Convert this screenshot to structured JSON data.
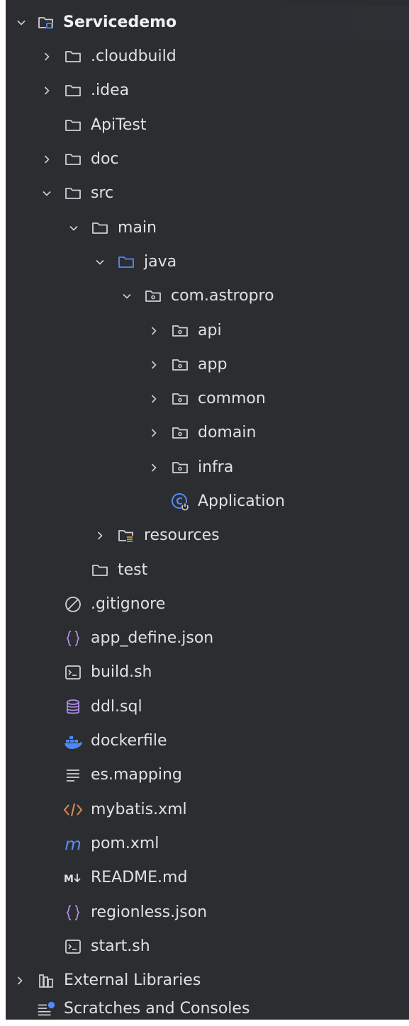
{
  "tree": {
    "root": {
      "label": "Servicedemo"
    },
    "items": [
      {
        "label": ".cloudbuild"
      },
      {
        "label": ".idea"
      },
      {
        "label": "ApiTest"
      },
      {
        "label": "doc"
      },
      {
        "label": "src"
      },
      {
        "label": "main"
      },
      {
        "label": "java"
      },
      {
        "label": "com.astropro"
      },
      {
        "label": "api"
      },
      {
        "label": "app"
      },
      {
        "label": "common"
      },
      {
        "label": "domain"
      },
      {
        "label": "infra"
      },
      {
        "label": "Application"
      },
      {
        "label": "resources"
      },
      {
        "label": "test"
      },
      {
        "label": ".gitignore"
      },
      {
        "label": "app_define.json"
      },
      {
        "label": "build.sh"
      },
      {
        "label": "ddl.sql"
      },
      {
        "label": "dockerfile"
      },
      {
        "label": "es.mapping"
      },
      {
        "label": "mybatis.xml"
      },
      {
        "label": "pom.xml"
      },
      {
        "label": "README.md"
      },
      {
        "label": "regionless.json"
      },
      {
        "label": "start.sh"
      },
      {
        "label": "External Libraries"
      },
      {
        "label": "Scratches and Consoles"
      }
    ]
  },
  "icons": {
    "folder": "folder-icon",
    "module": "module-icon",
    "source-root": "source-root-folder-icon",
    "package": "package-icon",
    "resources-root": "resources-root-folder-icon",
    "spring-boot-class": "spring-boot-application-icon",
    "ignore": "gitignore-icon",
    "json": "json-icon",
    "shell": "shell-script-icon",
    "sql": "sql-database-icon",
    "docker": "docker-icon",
    "text": "text-file-icon",
    "xml": "xml-icon",
    "maven": "maven-icon",
    "markdown": "markdown-icon",
    "libraries": "external-libraries-icon",
    "scratches": "scratches-icon"
  },
  "colors": {
    "panel_bg": "#2b2d30",
    "text": "#dfe1e5",
    "folder_stroke": "#ced0d6",
    "source_folder": "#548af7",
    "json_brace": "#b08ee6",
    "sql_db": "#b08ee6",
    "docker_blue": "#4f88f0",
    "xml_orange": "#e08855",
    "maven_blue": "#5a8cf0"
  }
}
